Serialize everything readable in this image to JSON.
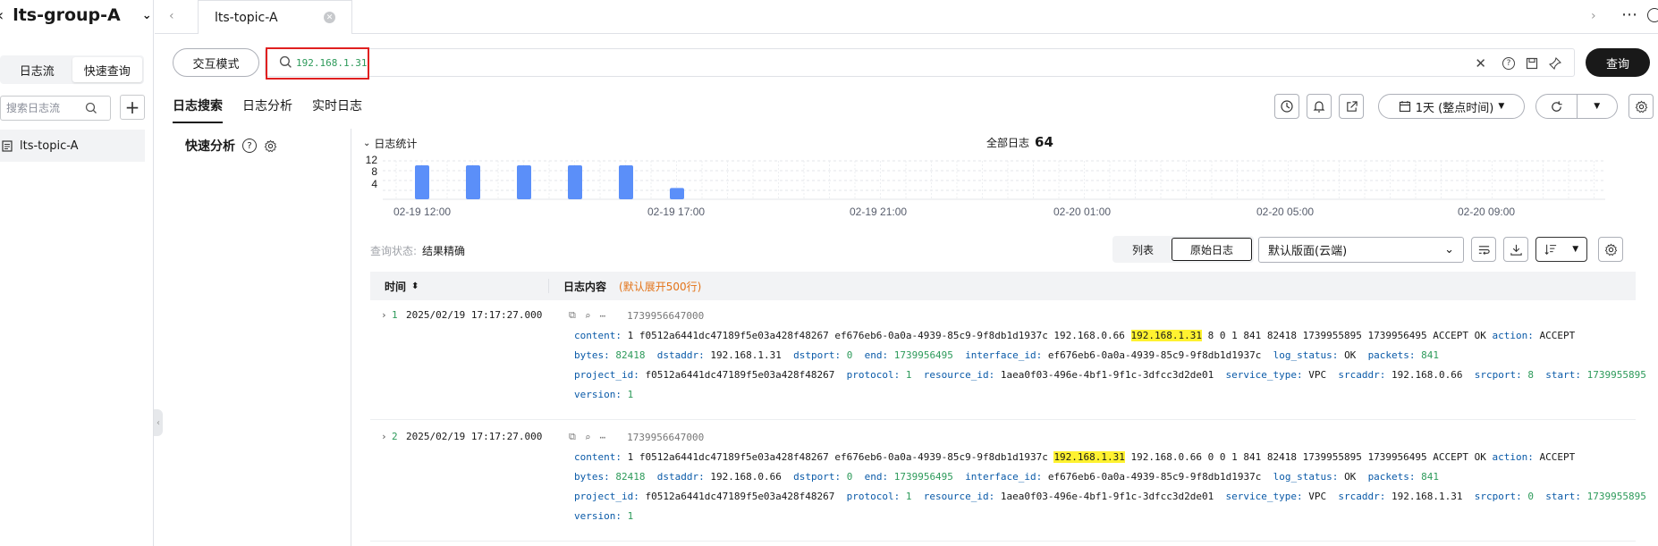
{
  "sidebar": {
    "title": "lts-group-A",
    "tabs": [
      "日志流",
      "快速查询"
    ],
    "search_placeholder": "搜索日志流",
    "stream_item": "lts-topic-A"
  },
  "tabstrip": {
    "active_tab": "lts-topic-A"
  },
  "query": {
    "mode_label": "交互模式",
    "text": "192.168.1.31",
    "submit_label": "查询"
  },
  "subtabs": [
    "日志搜索",
    "日志分析",
    "实时日志"
  ],
  "time_range": "1天 (整点时间)",
  "quick_analysis_label": "快速分析",
  "histogram": {
    "title": "日志统计",
    "total_label": "全部日志",
    "total": "64"
  },
  "chart_data": {
    "type": "bar",
    "y_ticks": [
      "12",
      "8",
      "4"
    ],
    "x_ticks": [
      "02-19 12:00",
      "02-19 17:00",
      "02-19 21:00",
      "02-20 01:00",
      "02-20 05:00",
      "02-20 09:00"
    ],
    "bar_values": [
      12,
      12,
      12,
      12,
      12,
      4
    ],
    "ylim": [
      0,
      12
    ]
  },
  "status": {
    "label": "查询状态:",
    "value": "结果精确"
  },
  "view_modes": [
    "列表",
    "原始日志"
  ],
  "layout_select": "默认版面(云端)",
  "table": {
    "col_time": "时间",
    "col_content": "日志内容",
    "col_note": "(默认展开500行)"
  },
  "rows": [
    {
      "index": "1",
      "time": "2025/02/19 17:17:27.000",
      "ts": "1739956647000",
      "content_pre": "1 f0512a6441dc47189f5e03a428f48267 ef676eb6-0a0a-4939-85c9-9f8db1d1937c 192.168.0.66",
      "content_hl": "192.168.1.31",
      "content_post": "8 0 1 841 82418 1739955895 1739956495 ACCEPT OK",
      "action": "ACCEPT",
      "bytes": "82418",
      "dstaddr": "192.168.1.31",
      "dstport": "0",
      "end": "1739956495",
      "interface_id": "ef676eb6-0a0a-4939-85c9-9f8db1d1937c",
      "log_status": "OK",
      "packets": "841",
      "project_id": "f0512a6441dc47189f5e03a428f48267",
      "protocol": "1",
      "resource_id": "1aea0f03-496e-4bf1-9f1c-3dfcc3d2de01",
      "service_type": "VPC",
      "srcaddr": "192.168.0.66",
      "srcport": "8",
      "start": "1739955895",
      "version": "1"
    },
    {
      "index": "2",
      "time": "2025/02/19 17:17:27.000",
      "ts": "1739956647000",
      "content_pre": "1 f0512a6441dc47189f5e03a428f48267 ef676eb6-0a0a-4939-85c9-9f8db1d1937c",
      "content_hl": "192.168.1.31",
      "content_post": "192.168.0.66 0 0 1 841 82418 1739955895 1739956495 ACCEPT OK",
      "action": "ACCEPT",
      "bytes": "82418",
      "dstaddr": "192.168.0.66",
      "dstport": "0",
      "end": "1739956495",
      "interface_id": "ef676eb6-0a0a-4939-85c9-9f8db1d1937c",
      "log_status": "OK",
      "packets": "841",
      "project_id": "f0512a6441dc47189f5e03a428f48267",
      "protocol": "1",
      "resource_id": "1aea0f03-496e-4bf1-9f1c-3dfcc3d2de01",
      "service_type": "VPC",
      "srcaddr": "192.168.1.31",
      "srcport": "0",
      "start": "1739955895",
      "version": "1"
    }
  ],
  "field_labels": {
    "content": "content:",
    "action": "action:",
    "bytes": "bytes:",
    "dstaddr": "dstaddr:",
    "dstport": "dstport:",
    "end": "end:",
    "interface_id": "interface_id:",
    "log_status": "log_status:",
    "packets": "packets:",
    "project_id": "project_id:",
    "protocol": "protocol:",
    "resource_id": "resource_id:",
    "service_type": "service_type:",
    "srcaddr": "srcaddr:",
    "srcport": "srcport:",
    "start": "start:",
    "version": "version:"
  },
  "colors": {
    "accent": "#5b8ff9",
    "highlight": "#fff230",
    "key": "#0a5aa8",
    "green": "#2d9a5a",
    "orange": "#e37318",
    "red_frame": "#e02020"
  }
}
